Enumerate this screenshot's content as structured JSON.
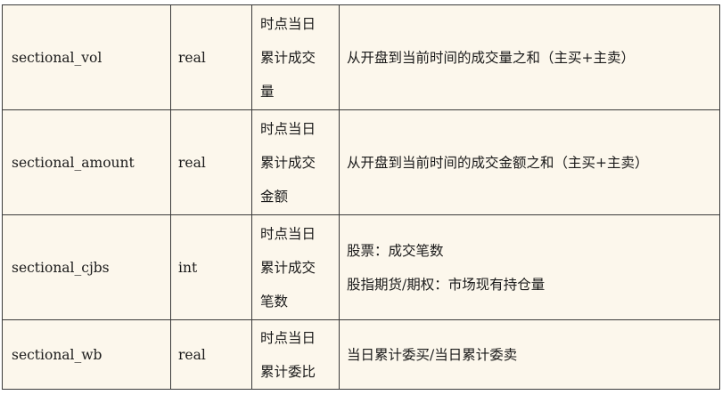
{
  "rows": [
    {
      "name": "sectional_vol",
      "type": "real",
      "label_lines": [
        "时点当日",
        "累计成交",
        "量"
      ],
      "desc_lines": [
        "从开盘到当前时间的成交量之和（主买+主卖）"
      ]
    },
    {
      "name": "sectional_amount",
      "type": "real",
      "label_lines": [
        "时点当日",
        "累计成交",
        "金额"
      ],
      "desc_lines": [
        "从开盘到当前时间的成交金额之和（主买+主卖）"
      ]
    },
    {
      "name": "sectional_cjbs",
      "type": "int",
      "label_lines": [
        "时点当日",
        "累计成交",
        "笔数"
      ],
      "desc_lines": [
        "股票：成交笔数",
        "股指期货/期权：市场现有持仓量"
      ]
    },
    {
      "name": "sectional_wb",
      "type": "real",
      "label_lines": [
        "时点当日",
        "累计委比"
      ],
      "desc_lines": [
        "当日累计委买/当日累计委卖"
      ]
    }
  ]
}
